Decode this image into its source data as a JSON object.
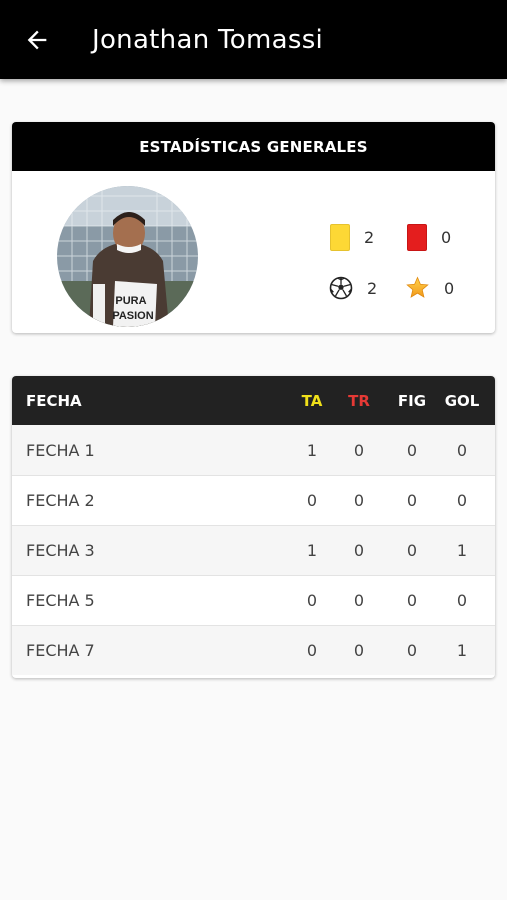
{
  "appbar": {
    "title": "Jonathan Tomassi",
    "back_icon": "arrow-left-icon"
  },
  "stats": {
    "header": "ESTADÍSTICAS GENERALES",
    "yellow_cards": "2",
    "red_cards": "0",
    "goals": "2",
    "mvp": "0",
    "colors": {
      "yellow": "#fdd835",
      "red": "#e41e1e",
      "star": "#f5a623"
    }
  },
  "table": {
    "headers": {
      "name": "FECHA",
      "ta": "TA",
      "tr": "TR",
      "fig": "FIG",
      "gol": "GOL"
    },
    "header_colors": {
      "ta": "#f0e01a",
      "tr": "#e53935"
    },
    "rows": [
      {
        "name": "FECHA 1",
        "ta": "1",
        "tr": "0",
        "fig": "0",
        "gol": "0"
      },
      {
        "name": "FECHA 2",
        "ta": "0",
        "tr": "0",
        "fig": "0",
        "gol": "0"
      },
      {
        "name": "FECHA 3",
        "ta": "1",
        "tr": "0",
        "fig": "0",
        "gol": "1"
      },
      {
        "name": "FECHA 5",
        "ta": "0",
        "tr": "0",
        "fig": "0",
        "gol": "0"
      },
      {
        "name": "FECHA 7",
        "ta": "0",
        "tr": "0",
        "fig": "0",
        "gol": "1"
      }
    ]
  }
}
